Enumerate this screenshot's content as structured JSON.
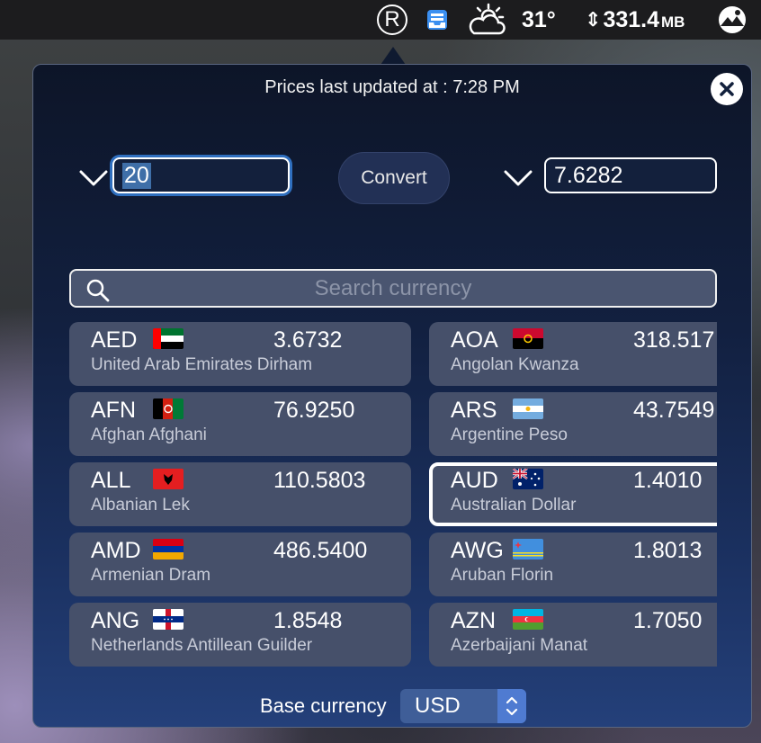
{
  "menubar": {
    "r_label": "R",
    "temperature": "31°",
    "memory_arrows": "⇕",
    "memory_value": "331.4",
    "memory_unit": "MB",
    "icons": [
      "r-circle-icon",
      "inbox-icon",
      "cloud-sun-icon",
      "memory-arrows-icon",
      "photo-icon"
    ]
  },
  "popover": {
    "updated_text": "Prices last updated at : 7:28 PM",
    "from_amount": "20",
    "to_amount": "7.6282",
    "convert_label": "Convert",
    "search_placeholder": "Search currency",
    "base_label": "Base currency",
    "base_value": "USD",
    "accent_color": "#4f7bd1"
  },
  "currencies": [
    {
      "code": "AED",
      "rate": "3.6732",
      "name": "United Arab Emirates Dirham",
      "flag": "ae"
    },
    {
      "code": "AOA",
      "rate": "318.517",
      "name": "Angolan Kwanza",
      "flag": "ao"
    },
    {
      "code": "AFN",
      "rate": "76.9250",
      "name": "Afghan Afghani",
      "flag": "af"
    },
    {
      "code": "ARS",
      "rate": "43.7549",
      "name": "Argentine Peso",
      "flag": "ar"
    },
    {
      "code": "ALL",
      "rate": "110.5803",
      "name": "Albanian Lek",
      "flag": "al"
    },
    {
      "code": "AUD",
      "rate": "1.4010",
      "name": "Australian Dollar",
      "flag": "au",
      "selected": true
    },
    {
      "code": "AMD",
      "rate": "486.5400",
      "name": "Armenian Dram",
      "flag": "am"
    },
    {
      "code": "AWG",
      "rate": "1.8013",
      "name": "Aruban Florin",
      "flag": "aw"
    },
    {
      "code": "ANG",
      "rate": "1.8548",
      "name": "Netherlands Antillean Guilder",
      "flag": "an"
    },
    {
      "code": "AZN",
      "rate": "1.7050",
      "name": "Azerbaijani Manat",
      "flag": "az"
    }
  ]
}
